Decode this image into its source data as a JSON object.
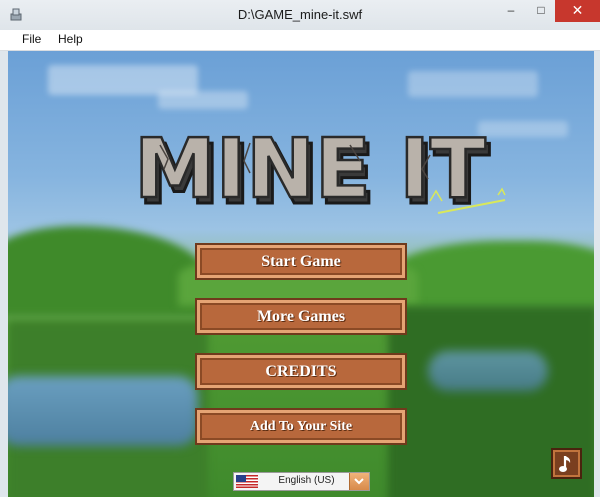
{
  "window": {
    "title": "D:\\GAME_mine-it.swf",
    "controls": {
      "minimize": "–",
      "maximize": "□",
      "close": "✕"
    }
  },
  "menubar": {
    "items": [
      {
        "label": "File"
      },
      {
        "label": "Help"
      }
    ]
  },
  "game": {
    "logo_text": "MINE IT",
    "buttons": [
      {
        "label": "Start Game"
      },
      {
        "label": "More Games"
      },
      {
        "label": "CREDITS"
      },
      {
        "label": "Add To Your Site"
      }
    ],
    "language": {
      "selected": "English (US)",
      "flag_icon": "us-flag-icon"
    },
    "music_icon": "music-note-icon"
  },
  "colors": {
    "button_fill": "#b8683c",
    "button_border": "#6f3a1c",
    "button_highlight": "#e5a474",
    "close_button": "#c7372d"
  }
}
